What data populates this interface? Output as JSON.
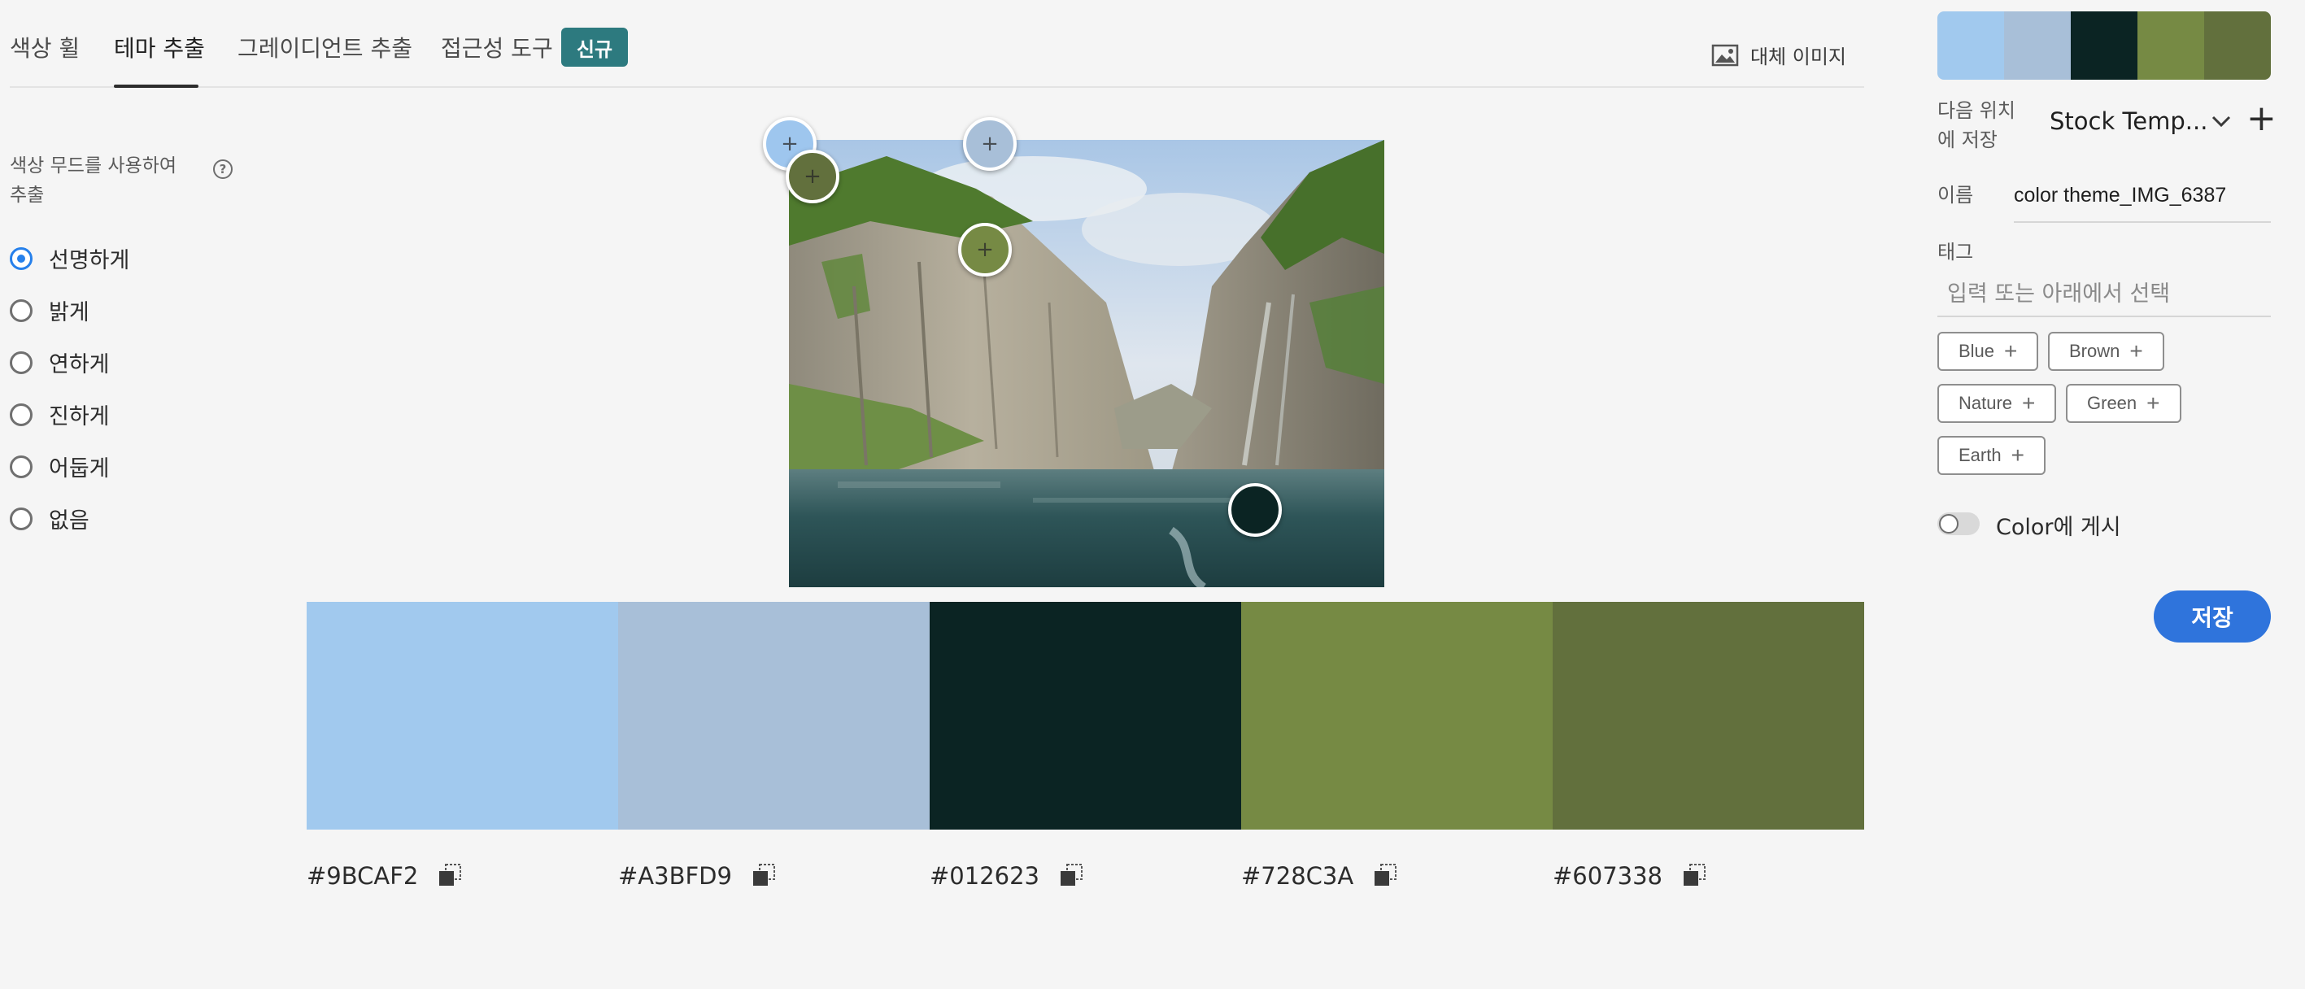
{
  "tabs": {
    "items": [
      {
        "label": "색상 휠"
      },
      {
        "label": "테마 추출"
      },
      {
        "label": "그레이디언트 추출"
      },
      {
        "label": "접근성 도구"
      }
    ],
    "new_badge": "신규",
    "alt_image_label": "대체 이미지"
  },
  "mood": {
    "title": "색상 무드를 사용하여 추출",
    "help": "?",
    "options": [
      {
        "label": "선명하게",
        "checked": true
      },
      {
        "label": "밝게",
        "checked": false
      },
      {
        "label": "연하게",
        "checked": false
      },
      {
        "label": "진하게",
        "checked": false
      },
      {
        "label": "어둡게",
        "checked": false
      },
      {
        "label": "없음",
        "checked": false
      }
    ]
  },
  "markers": {
    "plus": "+"
  },
  "palette": {
    "colors": [
      {
        "hex": "#9BCAF2",
        "color": "#A1C9EE"
      },
      {
        "hex": "#A3BFD9",
        "color": "#A8BFD8"
      },
      {
        "hex": "#012623",
        "color": "#0B2423"
      },
      {
        "hex": "#728C3A",
        "color": "#768A44"
      },
      {
        "hex": "#607338",
        "color": "#62703D"
      }
    ]
  },
  "right_panel": {
    "save_to_label": "다음 위치에 저장",
    "library_value": "Stock Temp...",
    "add_label": "+",
    "name_label": "이름",
    "name_value": "color theme_IMG_6387",
    "tag_label": "태그",
    "tag_placeholder": "입력 또는 아래에서 선택",
    "tags": [
      {
        "label": "Blue"
      },
      {
        "label": "Brown"
      },
      {
        "label": "Nature"
      },
      {
        "label": "Green"
      },
      {
        "label": "Earth"
      }
    ],
    "publish_label": "Color에 게시",
    "publish_on": false,
    "save_button": "저장"
  }
}
